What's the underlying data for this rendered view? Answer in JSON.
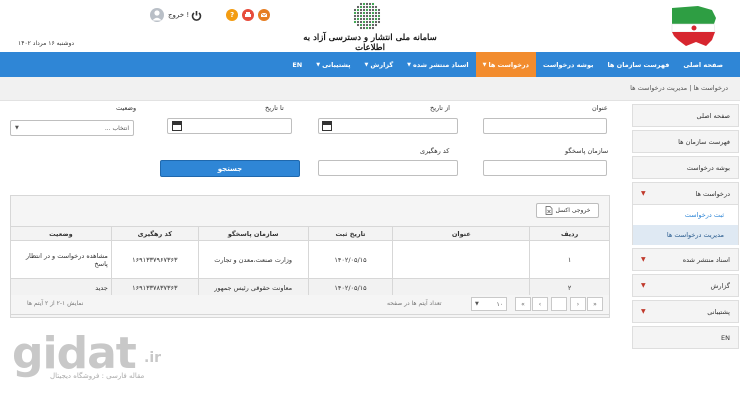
{
  "header": {
    "system_title": "سامانه ملی انتشار و دسترسی آزاد به اطلاعات",
    "date": "دوشنبه ۱۶ مرداد ۱۴۰۲",
    "exit_label": "خروج !",
    "icon_colors": {
      "red": "#e0393e",
      "orange": "#f39c12",
      "orange2": "#e67e22"
    }
  },
  "navbar": {
    "items": [
      {
        "label": "صفحه اصلی",
        "caret": false,
        "active": false
      },
      {
        "label": "فهرست سازمان ها",
        "caret": false,
        "active": false
      },
      {
        "label": "بوشه درخواست",
        "caret": false,
        "active": false
      },
      {
        "label": "درخواست ها",
        "caret": true,
        "active": true
      },
      {
        "label": "اسناد منتشر شده",
        "caret": true,
        "active": false
      },
      {
        "label": "گزارش",
        "caret": true,
        "active": false
      },
      {
        "label": "پشتیبانی",
        "caret": true,
        "active": false
      },
      {
        "label": "EN",
        "caret": false,
        "active": false
      }
    ],
    "color": "#2f86d6",
    "active_color": "#f28c2e"
  },
  "breadcrumb": {
    "text": "درخواست ها   |   مدیریت درخواست ها"
  },
  "sidebar": {
    "items": [
      {
        "label": "صفحه اصلی"
      },
      {
        "label": "فهرست سازمان ها"
      },
      {
        "label": "بوشه درخواست"
      },
      {
        "label": "درخواست ها"
      },
      {
        "label": "اسناد منتشر شده"
      },
      {
        "label": "گزارش"
      },
      {
        "label": "پشتیبانی"
      },
      {
        "label": "EN"
      }
    ],
    "sub_items": [
      {
        "label": "ثبت درخواست"
      },
      {
        "label": "مدیریت درخواست ها"
      }
    ]
  },
  "form": {
    "title_label": "عنوان",
    "from_date_label": "از تاریخ",
    "to_date_label": "تا تاریخ",
    "status_label": "وضعیت",
    "status_value": "انتخاب ...",
    "responder_label": "سازمان پاسخگو",
    "tracking_label": "کد رهگیری",
    "search_label": "جستجو"
  },
  "panel": {
    "excel_label": "خروجی اکسل"
  },
  "table": {
    "headers": [
      "ردیف",
      "عنوان",
      "تاریخ ثبت",
      "سازمان پاسخگو",
      "کد رهگیری",
      "وضعیت"
    ],
    "rows": [
      {
        "num": "۱",
        "title": "",
        "date": "۱۴۰۲/۰۵/۱۵",
        "org": "وزارت صنعت،معدن و تجارت",
        "code": "۱۶۹۱۳۳۷۹۶۷۳۶۳",
        "status": "مشاهده درخواست و در انتظار پاسخ"
      },
      {
        "num": "۲",
        "title": "",
        "date": "۱۴۰۲/۰۵/۱۵",
        "org": "معاونت حقوقی رئیس جمهور",
        "code": "۱۶۹۱۳۳۷۸۳۷۳۶۳",
        "status": "جدید"
      }
    ]
  },
  "pager": {
    "page_size": "۱۰",
    "page_size_label": "تعداد آیتم ها در صفحه",
    "showing": "نمایش ۱-۲ از ۲ آیتم ها"
  },
  "watermark": {
    "logo": "gidat",
    "tld": ".ir",
    "tagline": "مقاله فارسی : فروشگاه دیجیتال"
  }
}
